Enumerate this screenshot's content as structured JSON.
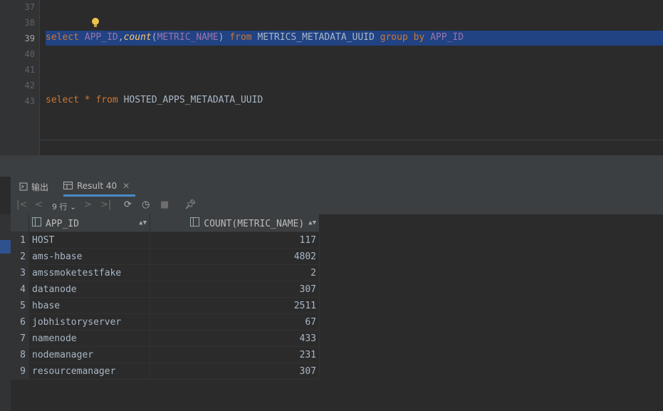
{
  "editor": {
    "line_numbers": [
      "37",
      "38",
      "39",
      "40",
      "41",
      "42",
      "43"
    ],
    "query1": {
      "select": "select",
      "app_id": "APP_ID",
      "comma": ",",
      "count": "count",
      "lparen": "(",
      "metric_name": "METRIC_NAME",
      "rparen": ")",
      "from": "from",
      "table": "METRICS_METADATA_UUID",
      "group_by": "group by",
      "group_col": "APP_ID"
    },
    "query2": {
      "select": "select",
      "star": "*",
      "from": "from",
      "table": "HOSTED_APPS_METADATA_UUID"
    }
  },
  "tabs": [
    {
      "label": "输出",
      "icon": "output-icon"
    },
    {
      "label": "Result 40",
      "icon": "table-icon"
    }
  ],
  "toolbar": {
    "row_count": "9 行"
  },
  "results": {
    "columns": [
      "APP_ID",
      "COUNT(METRIC_NAME)"
    ],
    "rows": [
      {
        "n": "1",
        "app_id": "HOST",
        "count": "117"
      },
      {
        "n": "2",
        "app_id": "ams-hbase",
        "count": "4802"
      },
      {
        "n": "3",
        "app_id": "amssmoketestfake",
        "count": "2"
      },
      {
        "n": "4",
        "app_id": "datanode",
        "count": "307"
      },
      {
        "n": "5",
        "app_id": "hbase",
        "count": "2511"
      },
      {
        "n": "6",
        "app_id": "jobhistoryserver",
        "count": "67"
      },
      {
        "n": "7",
        "app_id": "namenode",
        "count": "433"
      },
      {
        "n": "8",
        "app_id": "nodemanager",
        "count": "231"
      },
      {
        "n": "9",
        "app_id": "resourcemanager",
        "count": "307"
      }
    ]
  },
  "colors": {
    "selection": "#214283",
    "keyword": "#cc7832",
    "column": "#9876aa",
    "function": "#ffc66d",
    "check": "#499c54"
  }
}
